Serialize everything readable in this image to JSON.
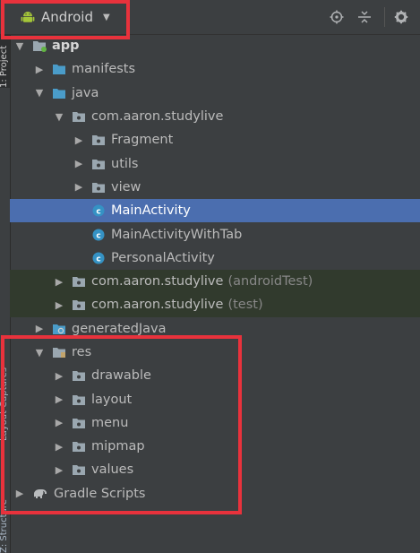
{
  "side_tabs": {
    "project": "1: Project",
    "layout_captures": "Layout Captures",
    "structure": "Z: Structure"
  },
  "toolbar": {
    "view_label": "Android",
    "icons": [
      "android-icon",
      "locate-icon",
      "collapse-all-icon",
      "gear-icon"
    ]
  },
  "tree": {
    "app": "app",
    "manifests": "manifests",
    "java": "java",
    "pkg_main": "com.aaron.studylive",
    "fragment": "Fragment",
    "utils": "utils",
    "view": "view",
    "main_activity": "MainActivity",
    "main_activity_tab": "MainActivityWithTab",
    "personal_activity": "PersonalActivity",
    "pkg_android_test": "com.aaron.studylive",
    "android_test_suffix": "(androidTest)",
    "pkg_test": "com.aaron.studylive",
    "test_suffix": "(test)",
    "generated_java": "generatedJava",
    "res": "res",
    "drawable": "drawable",
    "layout": "layout",
    "menu": "menu",
    "mipmap": "mipmap",
    "values": "values",
    "gradle_scripts": "Gradle Scripts"
  },
  "colors": {
    "background": "#3c3f41",
    "selection": "#4b6eaf",
    "annotation": "#e8323c",
    "android_green": "#a4c639",
    "folder_blue": "#4a9cc9",
    "class_cyan": "#3592c4"
  }
}
